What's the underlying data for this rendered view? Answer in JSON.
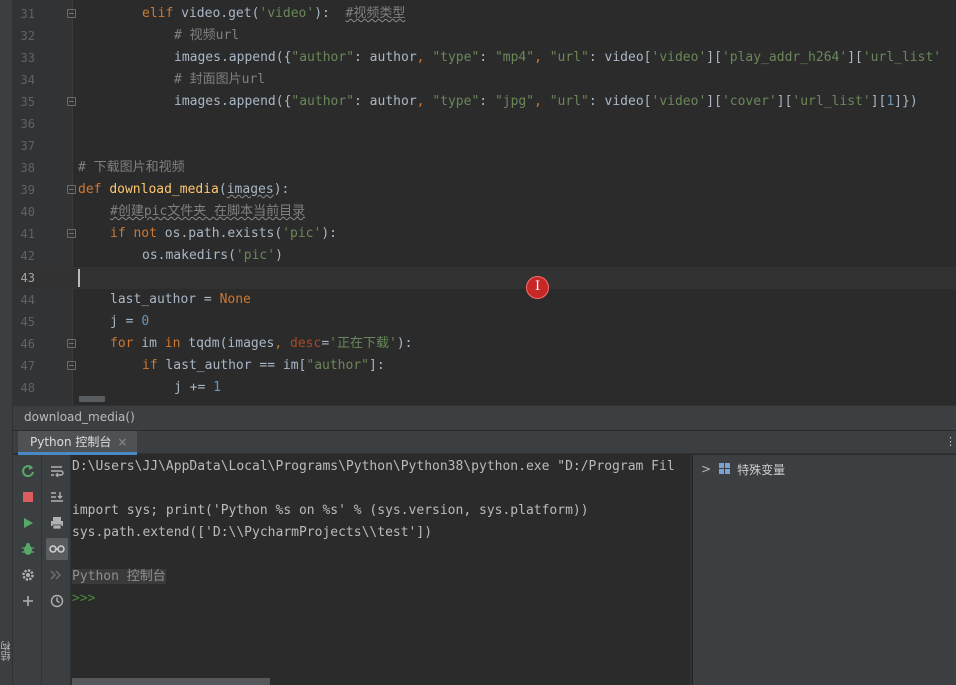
{
  "editor": {
    "lines": [
      {
        "num": "31",
        "fold": true
      },
      {
        "num": "32",
        "fold": false
      },
      {
        "num": "33",
        "fold": false
      },
      {
        "num": "34",
        "fold": false
      },
      {
        "num": "35",
        "fold": true
      },
      {
        "num": "36",
        "fold": false
      },
      {
        "num": "37",
        "fold": false
      },
      {
        "num": "38",
        "fold": false
      },
      {
        "num": "39",
        "fold": true
      },
      {
        "num": "40",
        "fold": false
      },
      {
        "num": "41",
        "fold": true
      },
      {
        "num": "42",
        "fold": false
      },
      {
        "num": "43",
        "fold": false,
        "current": true
      },
      {
        "num": "44",
        "fold": false
      },
      {
        "num": "45",
        "fold": false
      },
      {
        "num": "46",
        "fold": true
      },
      {
        "num": "47",
        "fold": true
      },
      {
        "num": "48",
        "fold": false
      }
    ],
    "code": {
      "l31": {
        "t1": "elif",
        "t2": " video.get(",
        "t3": "'video'",
        "t4": "):  ",
        "t5": "#视频类型"
      },
      "l32": {
        "t1": "# 视频url"
      },
      "l33": {
        "t1": "images.append({",
        "t2": "\"author\"",
        "t3": ": author",
        "t4": ", ",
        "t5": "\"type\"",
        "t6": ": ",
        "t7": "\"mp4\"",
        "t8": ", ",
        "t9": "\"url\"",
        "t10": ": video[",
        "t11": "'video'",
        "t12": "][",
        "t13": "'play_addr_h264'",
        "t14": "][",
        "t15": "'url_list'"
      },
      "l34": {
        "t1": "# 封面图片url"
      },
      "l35": {
        "t1": "images.append({",
        "t2": "\"author\"",
        "t3": ": author",
        "t4": ", ",
        "t5": "\"type\"",
        "t6": ": ",
        "t7": "\"jpg\"",
        "t8": ", ",
        "t9": "\"url\"",
        "t10": ": video[",
        "t11": "'video'",
        "t12": "][",
        "t13": "'cover'",
        "t14": "][",
        "t15": "'url_list'",
        "t16": "][",
        "t17": "1",
        "t18": "]})"
      },
      "l38": {
        "t1": "# 下载图片和视频"
      },
      "l39": {
        "t1": "def",
        "t2": " ",
        "t3": "download_media",
        "t4": "(",
        "t5": "images",
        "t6": "):"
      },
      "l40": {
        "t1": "#创建pic文件夹 在脚本当前目录"
      },
      "l41": {
        "t1": "if not",
        "t2": " os.path.exists(",
        "t3": "'pic'",
        "t4": "):"
      },
      "l42": {
        "t1": "os.makedirs(",
        "t2": "'pic'",
        "t3": ")"
      },
      "l44": {
        "t1": "last_author = ",
        "t2": "None"
      },
      "l45": {
        "t1": "j = ",
        "t2": "0"
      },
      "l46": {
        "t1": "for",
        "t2": " im ",
        "t3": "in",
        "t4": " tqdm(images",
        "t5": ", ",
        "t6": "desc",
        "t7": "=",
        "t8": "'正在下载'",
        "t9": "):"
      },
      "l47": {
        "t1": "if",
        "t2": " last_author == im[",
        "t3": "\"author\"",
        "t4": "]:"
      },
      "l48": {
        "t1": "j += ",
        "t2": "1"
      }
    },
    "cursor_glyph": "I"
  },
  "breadcrumb": {
    "text": "download_media()"
  },
  "console": {
    "tab_label": "Python 控制台",
    "tab_close": "×",
    "tab_edge": "⋮",
    "lines": {
      "cmd": "D:\\Users\\JJ\\AppData\\Local\\Programs\\Python\\Python38\\python.exe \"D:/Program Fil",
      "import": "import sys; print('Python %s on %s' % (sys.version, sys.platform))",
      "extend": "sys.path.extend(['D:\\\\PycharmProjects\\\\test'])",
      "label": "Python 控制台",
      "prompt": ">>>"
    }
  },
  "variables": {
    "chevron": ">",
    "label": "特殊变量"
  },
  "side_tool": {
    "label": "结构"
  },
  "icons": {
    "rerun": "rerun-icon",
    "stop": "stop-icon",
    "run": "run-icon",
    "debug": "debug-icon",
    "settings": "settings-icon",
    "add": "add-icon",
    "soft_wrap": "soft-wrap-icon",
    "scroll_end": "scroll-to-end-icon",
    "print": "print-icon",
    "show_vars": "show-variables-icon",
    "history_next": "execute-history-icon",
    "history": "history-icon"
  },
  "colors": {
    "keyword": "#cc7832",
    "function": "#ffc66d",
    "string": "#6a8759",
    "number": "#6897bb",
    "comment": "#808080",
    "parameter": "#aa4926",
    "accent": "#4a88c7"
  }
}
